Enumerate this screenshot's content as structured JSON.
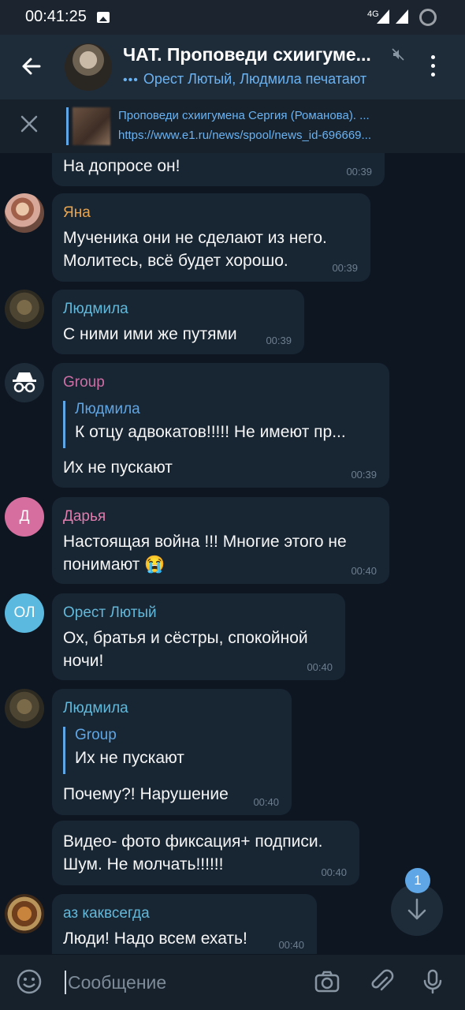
{
  "status_bar": {
    "time": "00:41:25",
    "network": "4G"
  },
  "header": {
    "title": "ЧАТ. Проповеди схиигуме...",
    "subtitle": "Орест Лютый, Людмила печатают"
  },
  "pinned": {
    "title": "Проповеди схиигумена Сергия (Романова). ...",
    "url": "https://www.e1.ru/news/spool/news_id-696669..."
  },
  "messages": [
    {
      "text": "На допросе он!",
      "time": "00:39"
    },
    {
      "sender": "Яна",
      "sender_color": "#e9a54f",
      "lines": [
        "Мученика они не сделают из него.",
        "Молитесь, всё будет хорошо."
      ],
      "time": "00:39"
    },
    {
      "sender": "Людмила",
      "sender_color": "#62b8d9",
      "text": "С ними ими же путями",
      "time": "00:39"
    },
    {
      "sender": "Group",
      "sender_color": "#cd6fa5",
      "reply_name": "Людмила",
      "reply_text": "К отцу адвокатов!!!!! Не имеют пр...",
      "text": "Их не пускают",
      "time": "00:39"
    },
    {
      "sender": "Дарья",
      "sender_color": "#e07cae",
      "avatar_letter": "Д",
      "avatar_color": "#d66fa0",
      "lines": [
        "Настоящая война !!! Многие этого не",
        "понимают 😭"
      ],
      "time": "00:40"
    },
    {
      "sender": "Орест Лютый",
      "sender_color": "#62b8d9",
      "avatar_letter": "ОЛ",
      "avatar_color": "#5bb8de",
      "lines": [
        "Ох, братья и сёстры, спокойной",
        "ночи!"
      ],
      "time": "00:40"
    },
    {
      "sender": "Людмила",
      "sender_color": "#62b8d9",
      "reply_name": "Group",
      "reply_text": "Их не пускают",
      "text": "Почему?! Нарушение",
      "time": "00:40"
    },
    {
      "lines": [
        "Видео- фото фиксация+ подписи.",
        "Шум. Не молчать!!!!!!"
      ],
      "time": "00:40"
    },
    {
      "sender": "аз каквсегда",
      "sender_color": "#62b8d9",
      "text": "Люди! Надо всем ехать!",
      "time": "00:40"
    }
  ],
  "scroll_badge": "1",
  "composer": {
    "placeholder": "Сообщение"
  },
  "icons": {
    "back": "arrow-left-icon",
    "mute": "muted-icon",
    "menu": "more-vertical-icon",
    "close": "close-icon",
    "emoji": "emoji-icon",
    "camera": "camera-icon",
    "attach": "paperclip-icon",
    "mic": "microphone-icon",
    "scroll": "arrow-down-icon"
  },
  "colors": {
    "accent": "#6ab3f3",
    "bubble": "#182533",
    "background": "#0e1621"
  }
}
